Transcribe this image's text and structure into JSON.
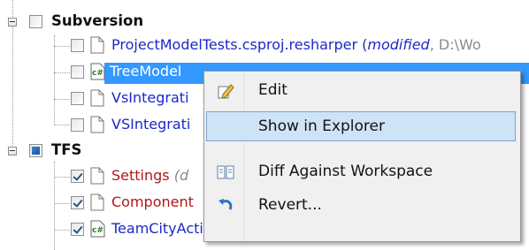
{
  "tree": {
    "svn_group": {
      "label": "Subversion"
    },
    "svn_items": [
      {
        "name": "ProjectModelTests.csproj.resharper",
        "detail_open": " (",
        "status": "modified",
        "detail_rest": ", D:\\Wo"
      },
      {
        "name": "TreeModel",
        "detail": ""
      },
      {
        "name": "VsIntegrati",
        "detail": ""
      },
      {
        "name": "VSIntegrati",
        "detail": ""
      }
    ],
    "tfs_group": {
      "label": "TFS"
    },
    "tfs_items": [
      {
        "name": "Settings",
        "detail": "(d"
      },
      {
        "name": "Component",
        "detail": ""
      },
      {
        "name": "TeamCityAction",
        "detail": ""
      }
    ]
  },
  "context_menu": {
    "items": [
      {
        "label": "Edit",
        "icon": "pencil-icon"
      },
      {
        "label": "Show in Explorer",
        "icon": ""
      },
      {
        "label": "Diff Against Workspace",
        "icon": "diff-icon"
      },
      {
        "label": "Revert...",
        "icon": "undo-icon"
      }
    ]
  },
  "colors": {
    "selection": "#3399ff",
    "menu_highlight": "#cfe3f6",
    "text_blue": "#1a28c8",
    "text_red": "#b01818"
  }
}
